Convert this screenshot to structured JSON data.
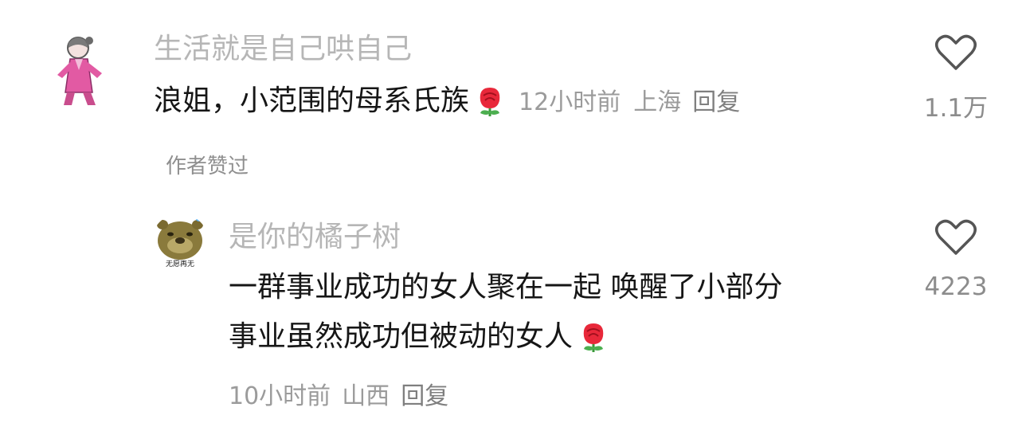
{
  "comments": [
    {
      "username": "生活就是自己哄自己",
      "text_line1": "浪姐，小范围的母系氏族",
      "emoji": "rose-icon",
      "time": "12小时前",
      "location": "上海",
      "reply_label": "回复",
      "like_count": "1.1万",
      "author_liked": "作者赞过"
    },
    {
      "username": "是你的橘子树",
      "text_line1": "一群事业成功的女人聚在一起 唤醒了小部分",
      "text_line2": "事业虽然成功但被动的女人",
      "emoji": "rose-icon",
      "time": "10小时前",
      "location": "山西",
      "reply_label": "回复",
      "like_count": "4223",
      "avatar_caption": "无愿再无"
    }
  ],
  "colors": {
    "username": "#b6b6b6",
    "content": "#161616",
    "meta": "#9b9b9b",
    "rose": "#e8283a"
  }
}
